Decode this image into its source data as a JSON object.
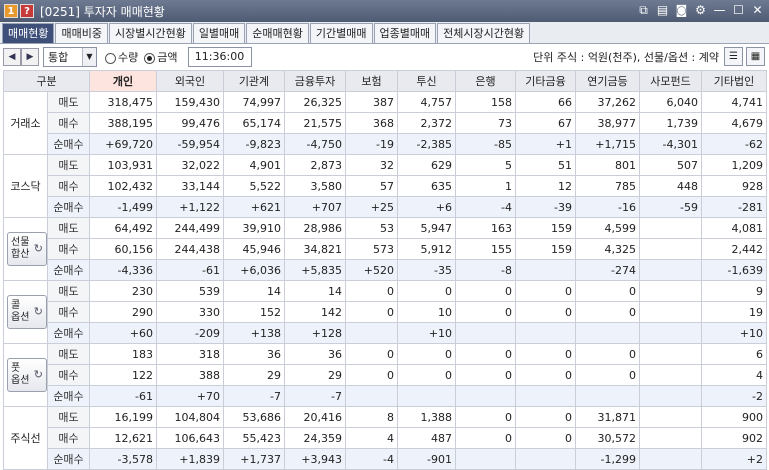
{
  "window": {
    "num": "1",
    "help": "?",
    "title": "[0251] 투자자 매매현황"
  },
  "tabs": [
    "매매현황",
    "매매비중",
    "시장별시간현황",
    "일별매매",
    "순매매현황",
    "기간별매매",
    "업종별매매",
    "전체시장시간현황"
  ],
  "toolbar": {
    "market": "통합",
    "radio_qty": "수량",
    "radio_amt": "금액",
    "time": "11:36:00",
    "unit": "단위 주식 : 억원(천주), 선물/옵션 : 계약"
  },
  "columns": [
    "구분",
    "개인",
    "외국인",
    "기관계",
    "금융투자",
    "보험",
    "투신",
    "은행",
    "기타금융",
    "연기금등",
    "사모펀드",
    "기타법인"
  ],
  "row_labels": {
    "sell": "매도",
    "buy": "매수",
    "net": "순매수"
  },
  "markets": [
    {
      "name": "거래소",
      "button": false,
      "sell": [
        "318,475",
        "159,430",
        "74,997",
        "26,325",
        "387",
        "4,757",
        "158",
        "66",
        "37,262",
        "6,040",
        "4,741"
      ],
      "buy": [
        "388,195",
        "99,476",
        "65,174",
        "21,575",
        "368",
        "2,372",
        "73",
        "67",
        "38,977",
        "1,739",
        "4,679"
      ],
      "net": [
        "+69,720",
        "-59,954",
        "-9,823",
        "-4,750",
        "-19",
        "-2,385",
        "-85",
        "+1",
        "+1,715",
        "-4,301",
        "-62"
      ]
    },
    {
      "name": "코스닥",
      "button": false,
      "sell": [
        "103,931",
        "32,022",
        "4,901",
        "2,873",
        "32",
        "629",
        "5",
        "51",
        "801",
        "507",
        "1,209"
      ],
      "buy": [
        "102,432",
        "33,144",
        "5,522",
        "3,580",
        "57",
        "635",
        "1",
        "12",
        "785",
        "448",
        "928"
      ],
      "net": [
        "-1,499",
        "+1,122",
        "+621",
        "+707",
        "+25",
        "+6",
        "-4",
        "-39",
        "-16",
        "-59",
        "-281"
      ]
    },
    {
      "name": "선물합산",
      "name_lines": [
        "선물",
        "합산"
      ],
      "button": true,
      "sell": [
        "64,492",
        "244,499",
        "39,910",
        "28,986",
        "53",
        "5,947",
        "163",
        "159",
        "4,599",
        "",
        "4,081"
      ],
      "buy": [
        "60,156",
        "244,438",
        "45,946",
        "34,821",
        "573",
        "5,912",
        "155",
        "159",
        "4,325",
        "",
        "2,442"
      ],
      "net": [
        "-4,336",
        "-61",
        "+6,036",
        "+5,835",
        "+520",
        "-35",
        "-8",
        "",
        "-274",
        "",
        "-1,639"
      ]
    },
    {
      "name": "콜옵션",
      "name_lines": [
        "콜",
        "옵션"
      ],
      "button": true,
      "sell": [
        "230",
        "539",
        "14",
        "14",
        "0",
        "0",
        "0",
        "0",
        "0",
        "",
        "9"
      ],
      "buy": [
        "290",
        "330",
        "152",
        "142",
        "0",
        "10",
        "0",
        "0",
        "0",
        "",
        "19"
      ],
      "net": [
        "+60",
        "-209",
        "+138",
        "+128",
        "",
        "+10",
        "",
        "",
        "",
        "",
        "+10"
      ]
    },
    {
      "name": "풋옵션",
      "name_lines": [
        "풋",
        "옵션"
      ],
      "button": true,
      "sell": [
        "183",
        "318",
        "36",
        "36",
        "0",
        "0",
        "0",
        "0",
        "0",
        "",
        "6"
      ],
      "buy": [
        "122",
        "388",
        "29",
        "29",
        "0",
        "0",
        "0",
        "0",
        "0",
        "",
        "4"
      ],
      "net": [
        "-61",
        "+70",
        "-7",
        "-7",
        "",
        "",
        "",
        "",
        "",
        "",
        "-2"
      ]
    },
    {
      "name": "주식선",
      "button": false,
      "sell": [
        "16,199",
        "104,804",
        "53,686",
        "20,416",
        "8",
        "1,388",
        "0",
        "0",
        "31,871",
        "",
        "900"
      ],
      "buy": [
        "12,621",
        "106,643",
        "55,423",
        "24,359",
        "4",
        "487",
        "0",
        "0",
        "30,572",
        "",
        "902"
      ],
      "net": [
        "-3,578",
        "+1,839",
        "+1,737",
        "+3,943",
        "-4",
        "-901",
        "",
        "",
        "-1,299",
        "",
        "+2"
      ]
    }
  ],
  "colors": {
    "positive": "#d6131a",
    "negative": "#1f3fc2",
    "active_tab": "#3e4f7a"
  }
}
